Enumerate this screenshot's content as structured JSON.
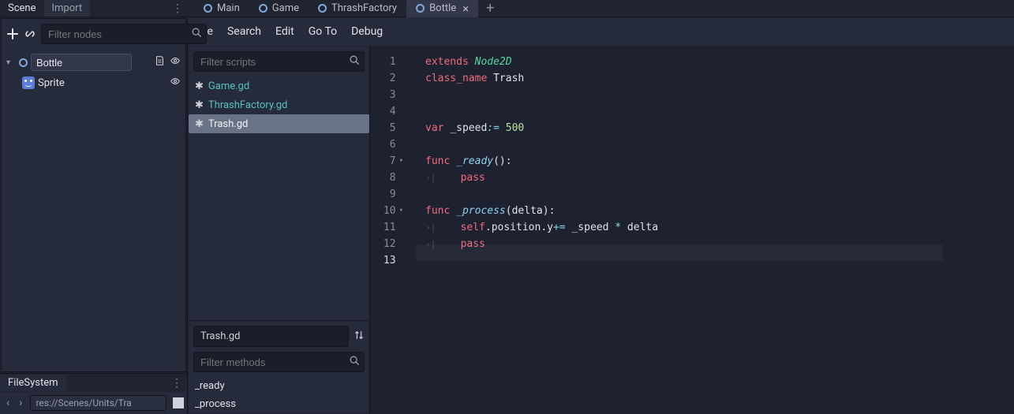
{
  "left_tabs": {
    "scene": "Scene",
    "import": "Import"
  },
  "scene_tabs": [
    {
      "label": "Main"
    },
    {
      "label": "Game"
    },
    {
      "label": "ThrashFactory"
    },
    {
      "label": "Bottle",
      "active": true
    }
  ],
  "file_menu": [
    "File",
    "Search",
    "Edit",
    "Go To",
    "Debug"
  ],
  "scene_toolbar": {
    "filter_placeholder": "Filter nodes"
  },
  "tree": {
    "root_name": "Bottle",
    "child_name": "Sprite"
  },
  "scripts_search_placeholder": "Filter scripts",
  "scripts": [
    {
      "name": "Game.gd"
    },
    {
      "name": "ThrashFactory.gd"
    },
    {
      "name": "Trash.gd",
      "selected": true
    }
  ],
  "current_script_name": "Trash.gd",
  "methods_filter_placeholder": "Filter methods",
  "methods": [
    "_ready",
    "_process"
  ],
  "filesystem": {
    "title": "FileSystem",
    "path": "res://Scenes/Units/Tra"
  },
  "code_lines": [
    {
      "n": 1,
      "tokens": [
        [
          "kw-red",
          "extends"
        ],
        [
          "sp",
          " "
        ],
        [
          "cls-green",
          "Node2D"
        ]
      ]
    },
    {
      "n": 2,
      "tokens": [
        [
          "kw-red",
          "class_name"
        ],
        [
          "sp",
          " "
        ],
        [
          "ident",
          "Trash"
        ]
      ]
    },
    {
      "n": 3,
      "tokens": []
    },
    {
      "n": 4,
      "tokens": []
    },
    {
      "n": 5,
      "tokens": [
        [
          "kw-red",
          "var"
        ],
        [
          "sp",
          " "
        ],
        [
          "ident",
          "_speed"
        ],
        [
          "builtin",
          ":="
        ],
        [
          "sp",
          " "
        ],
        [
          "num",
          "500"
        ]
      ]
    },
    {
      "n": 6,
      "tokens": []
    },
    {
      "n": 7,
      "fold": true,
      "tokens": [
        [
          "kw-red",
          "func"
        ],
        [
          "sp",
          " "
        ],
        [
          "builtin",
          "_ready"
        ],
        [
          "ident",
          "()"
        ],
        [
          "ident",
          ":"
        ]
      ]
    },
    {
      "n": 8,
      "indent": true,
      "tokens": [
        [
          "sp",
          "    "
        ],
        [
          "kw-red",
          "pass"
        ]
      ]
    },
    {
      "n": 9,
      "tokens": []
    },
    {
      "n": 10,
      "fold": true,
      "tokens": [
        [
          "kw-red",
          "func"
        ],
        [
          "sp",
          " "
        ],
        [
          "builtin",
          "_process"
        ],
        [
          "ident",
          "("
        ],
        [
          "ident",
          "delta"
        ],
        [
          "ident",
          ")"
        ],
        [
          "ident",
          ":"
        ]
      ]
    },
    {
      "n": 11,
      "indent": true,
      "tokens": [
        [
          "sp",
          "    "
        ],
        [
          "self",
          "self"
        ],
        [
          "ident",
          "."
        ],
        [
          "ident",
          "position"
        ],
        [
          "ident",
          "."
        ],
        [
          "ident",
          "y"
        ],
        [
          "builtin",
          "+="
        ],
        [
          "sp",
          " "
        ],
        [
          "ident",
          "_speed"
        ],
        [
          "sp",
          " "
        ],
        [
          "op",
          "*"
        ],
        [
          "sp",
          " "
        ],
        [
          "ident",
          "delta"
        ]
      ]
    },
    {
      "n": 12,
      "indent": true,
      "tokens": [
        [
          "sp",
          "    "
        ],
        [
          "kw-red",
          "pass"
        ]
      ]
    },
    {
      "n": 13,
      "current": true,
      "tokens": []
    }
  ]
}
